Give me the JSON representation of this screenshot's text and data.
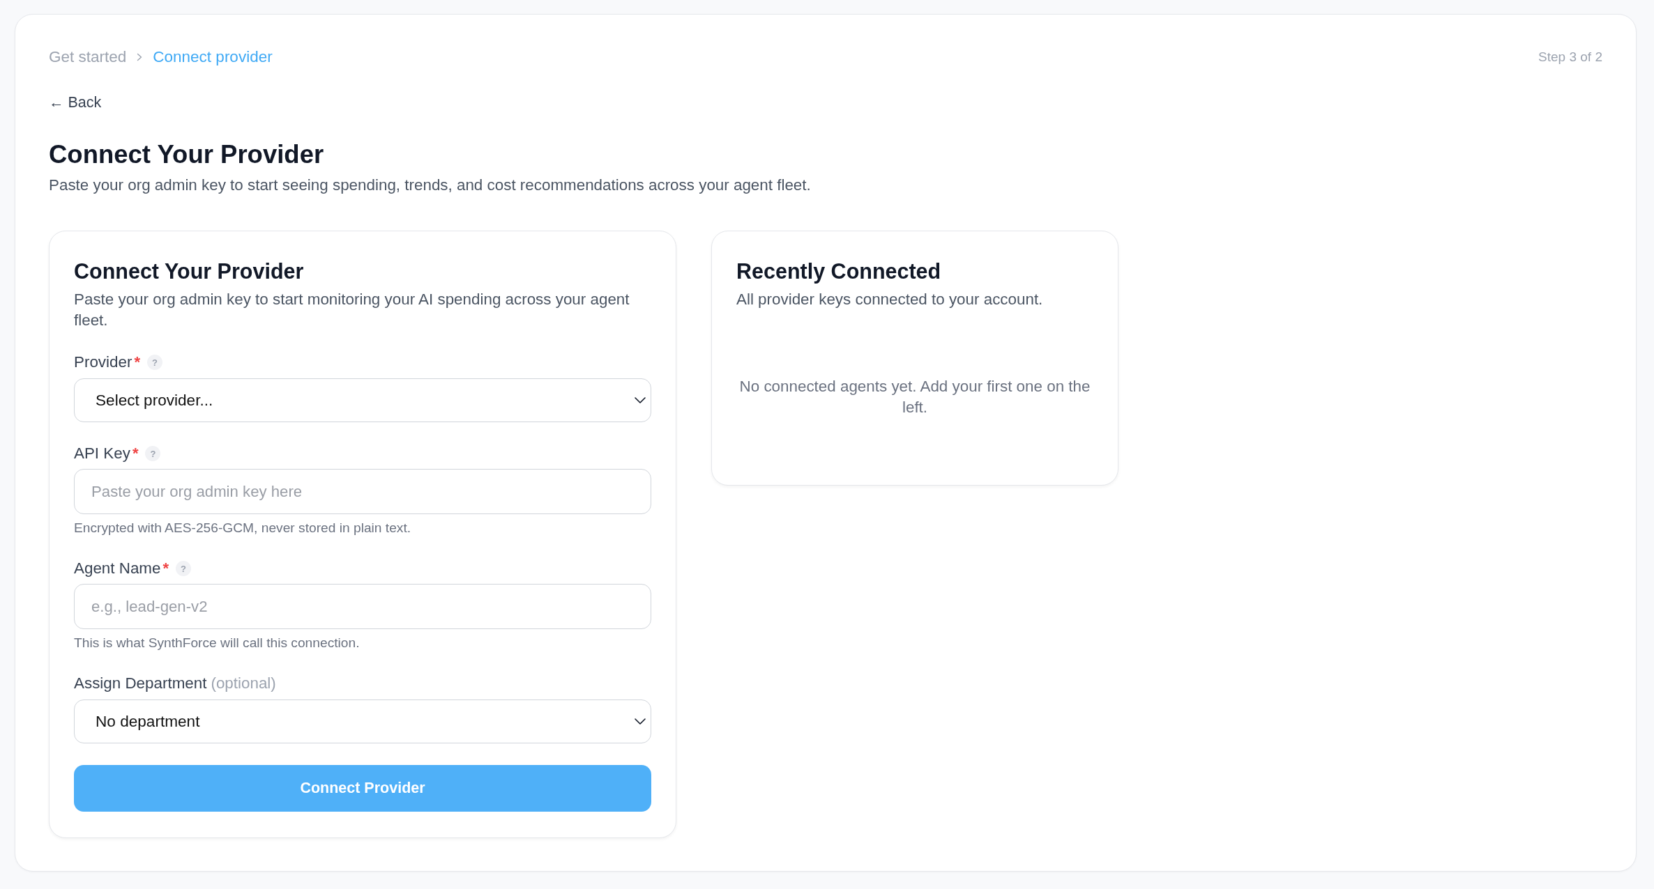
{
  "breadcrumb": [
    {
      "label": "Get started",
      "selected": false
    },
    {
      "label": "Connect provider",
      "selected": true
    }
  ],
  "step": "Step 3 of 2",
  "back_link": "← Back",
  "page": {
    "title": "Connect Your Provider",
    "subtitle": "Paste your org admin key to start seeing spending, trends, and cost recommendations across your agent fleet."
  },
  "form_card": {
    "title": "Connect Your Provider",
    "description": "Paste your org admin key to start monitoring your AI spending across your agent fleet.",
    "fields": [
      {
        "kind": "select",
        "label": "Provider",
        "required_mark": "*",
        "help": "?",
        "value": "Select provider..."
      },
      {
        "kind": "input",
        "label": "API Key",
        "required_mark": "*",
        "help": "?",
        "placeholder": "Paste your org admin key here",
        "hint": "Encrypted with AES-256-GCM, never stored in plain text."
      },
      {
        "kind": "input",
        "label": "Agent Name",
        "required_mark": "*",
        "help": "?",
        "placeholder": "e.g., lead-gen-v2",
        "hint": "This is what SynthForce will call this connection."
      },
      {
        "kind": "select",
        "label": "Assign Department",
        "note": "(optional)",
        "value": "No department"
      }
    ],
    "submit": "Connect Provider"
  },
  "recent_card": {
    "title": "Recently Connected",
    "description": "All provider keys connected to your account.",
    "empty_message": "No connected agents yet. Add your first one on the left."
  }
}
